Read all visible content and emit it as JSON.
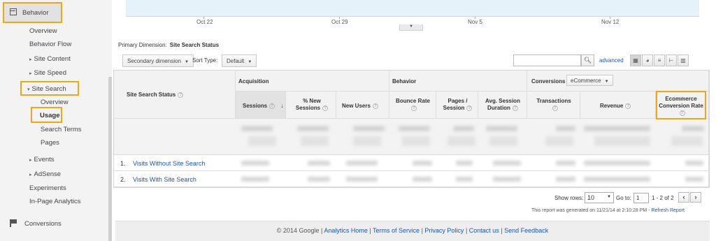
{
  "sidebar": {
    "behavior": "Behavior",
    "overview": "Overview",
    "behavior_flow": "Behavior Flow",
    "site_content": "Site Content",
    "site_speed": "Site Speed",
    "site_search": "Site Search",
    "site_search_overview": "Overview",
    "usage": "Usage",
    "search_terms": "Search Terms",
    "pages": "Pages",
    "events": "Events",
    "adsense": "AdSense",
    "experiments": "Experiments",
    "in_page_analytics": "In-Page Analytics",
    "conversions": "Conversions"
  },
  "chart": {
    "x_ticks": [
      "Oct 22",
      "Oct 29",
      "Nov 5",
      "Nov 12"
    ]
  },
  "primary_dimension": {
    "label": "Primary Dimension:",
    "value": "Site Search Status"
  },
  "controls": {
    "secondary_dimension": "Secondary dimension",
    "sort_type_label": "Sort Type:",
    "sort_default": "Default",
    "search_icon": "magnifier-icon",
    "advanced": "advanced",
    "view_icons": [
      "table-view-icon",
      "pie-view-icon",
      "performance-view-icon",
      "comparison-view-icon",
      "pivot-view-icon"
    ]
  },
  "table": {
    "dimension_header": "Site Search Status",
    "groups": {
      "acquisition": "Acquisition",
      "behavior": "Behavior",
      "conversions": "Conversions"
    },
    "conversion_select": "eCommerce",
    "columns": {
      "sessions": "Sessions",
      "pct_new_sessions_1": "% New",
      "pct_new_sessions_2": "Sessions",
      "new_users": "New Users",
      "bounce_rate_1": "Bounce Rate",
      "pages_session_1": "Pages /",
      "pages_session_2": "Session",
      "avg_session_1": "Avg. Session",
      "avg_session_2": "Duration",
      "transactions": "Transactions",
      "revenue": "Revenue",
      "ecomm_1": "Ecommerce",
      "ecomm_2": "Conversion Rate"
    },
    "rows": [
      {
        "num": "1.",
        "label": "Visits Without Site Search"
      },
      {
        "num": "2.",
        "label": "Visits With Site Search"
      }
    ]
  },
  "pagination": {
    "show_rows_label": "Show rows:",
    "rows_value": "10",
    "goto_label": "Go to:",
    "goto_value": "1",
    "range": "1 - 2 of 2",
    "prev": "‹",
    "next": "›"
  },
  "report_generated": "This report was generated on 11/21/14 at 2:10:28 PM - ",
  "refresh_report": "Refresh Report",
  "footer": {
    "copyright": "© 2014 Google | ",
    "analytics_home": "Analytics Home",
    "terms": "Terms of Service",
    "privacy": "Privacy Policy",
    "contact": "Contact us",
    "feedback": "Send Feedback",
    "sep": " | "
  },
  "colors": {
    "highlight": "#f1a51b",
    "link": "#1a55b5",
    "chart_fill": "#e6f2fa"
  }
}
